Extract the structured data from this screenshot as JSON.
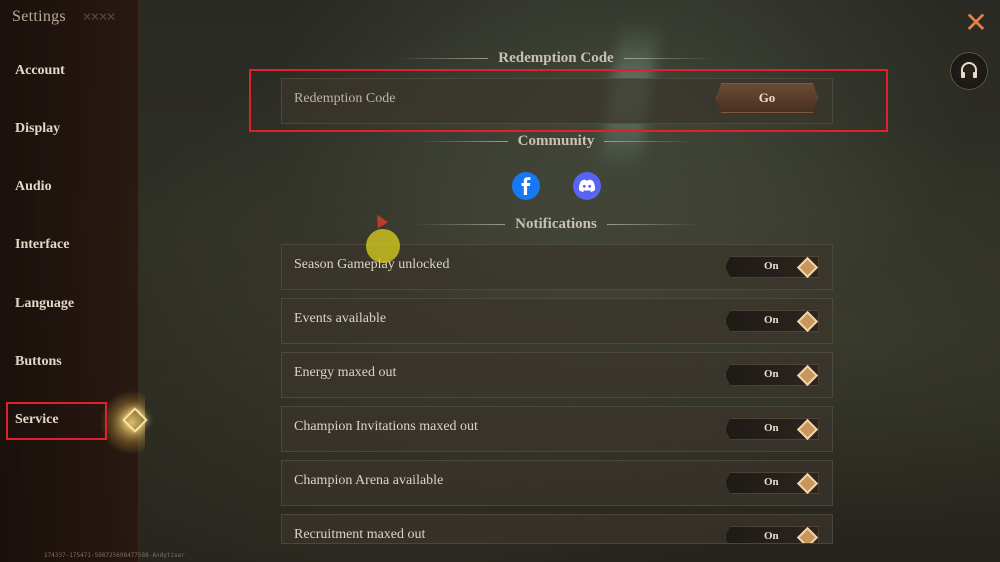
{
  "sidebar": {
    "title": "Settings",
    "items": [
      {
        "label": "Account"
      },
      {
        "label": "Display"
      },
      {
        "label": "Audio"
      },
      {
        "label": "Interface"
      },
      {
        "label": "Language"
      },
      {
        "label": "Buttons"
      },
      {
        "label": "Service"
      }
    ],
    "active": "Service"
  },
  "footer": {
    "id": "174337-175471-598725698477588-Andytiser"
  },
  "redemption": {
    "header": "Redemption Code",
    "label": "Redemption Code",
    "button": "Go"
  },
  "community": {
    "header": "Community",
    "links": [
      {
        "icon": "facebook-icon",
        "color": "#1877f2"
      },
      {
        "icon": "discord-icon",
        "color": "#5865f2"
      }
    ]
  },
  "notifications": {
    "header": "Notifications",
    "items": [
      {
        "label": "Season Gameplay unlocked",
        "state": "On"
      },
      {
        "label": "Events available",
        "state": "On"
      },
      {
        "label": "Energy maxed out",
        "state": "On"
      },
      {
        "label": "Champion Invitations maxed out",
        "state": "On"
      },
      {
        "label": "Champion Arena available",
        "state": "On"
      },
      {
        "label": "Recruitment maxed out",
        "state": "On"
      }
    ]
  },
  "colors": {
    "highlight": "#e0202a",
    "accent": "#c8955d"
  }
}
